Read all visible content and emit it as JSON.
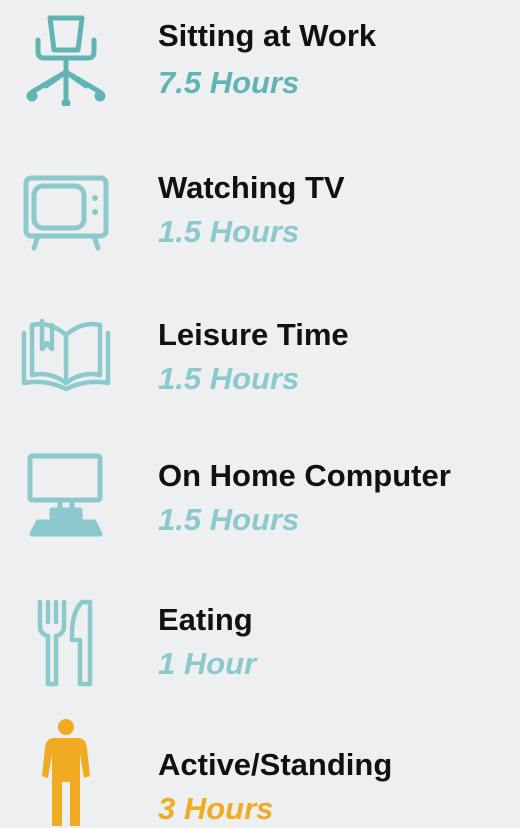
{
  "colors": {
    "background": "#eeeff0",
    "label": "#111111",
    "sedentary": "#62b3b5",
    "sedentary_light": "#8cc9cc",
    "active": "#f0ab22"
  },
  "items": [
    {
      "icon": "office-chair-icon",
      "label": "Sitting at Work",
      "value": "7.5 Hours"
    },
    {
      "icon": "television-icon",
      "label": "Watching TV",
      "value": "1.5 Hours"
    },
    {
      "icon": "open-book-icon",
      "label": "Leisure Time",
      "value": "1.5 Hours"
    },
    {
      "icon": "desktop-computer-icon",
      "label": "On Home Computer",
      "value": "1.5 Hours"
    },
    {
      "icon": "fork-knife-icon",
      "label": "Eating",
      "value": "1 Hour"
    },
    {
      "icon": "standing-person-icon",
      "label": "Active/Standing",
      "value": "3 Hours"
    }
  ]
}
